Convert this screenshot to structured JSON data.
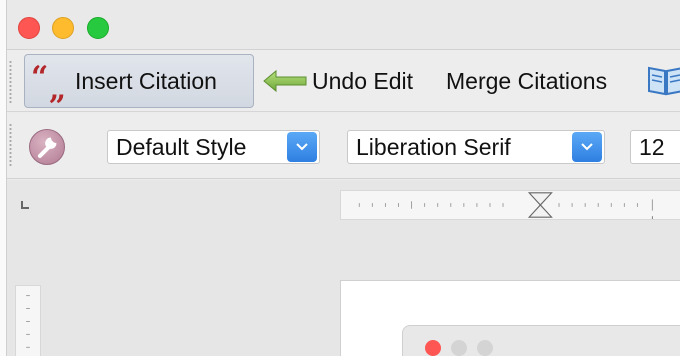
{
  "toolbar_main": {
    "insert_citation_label": "Insert Citation",
    "undo_edit_label": "Undo Edit",
    "merge_citations_label": "Merge Citations",
    "icons": [
      "quote-icon",
      "undo-arrow-icon",
      "book-icon"
    ]
  },
  "toolbar_format": {
    "paragraph_style": "Default Style",
    "font_name": "Liberation Serif",
    "font_size": "12",
    "icons": [
      "wrench-icon",
      "chevron-down-icon"
    ]
  },
  "colors": {
    "close": "#fd5653",
    "minimize": "#fdbb2d",
    "zoom": "#27c93f",
    "dropdown_accent": "#2f7fe2",
    "quote_icon": "#b3262a"
  }
}
